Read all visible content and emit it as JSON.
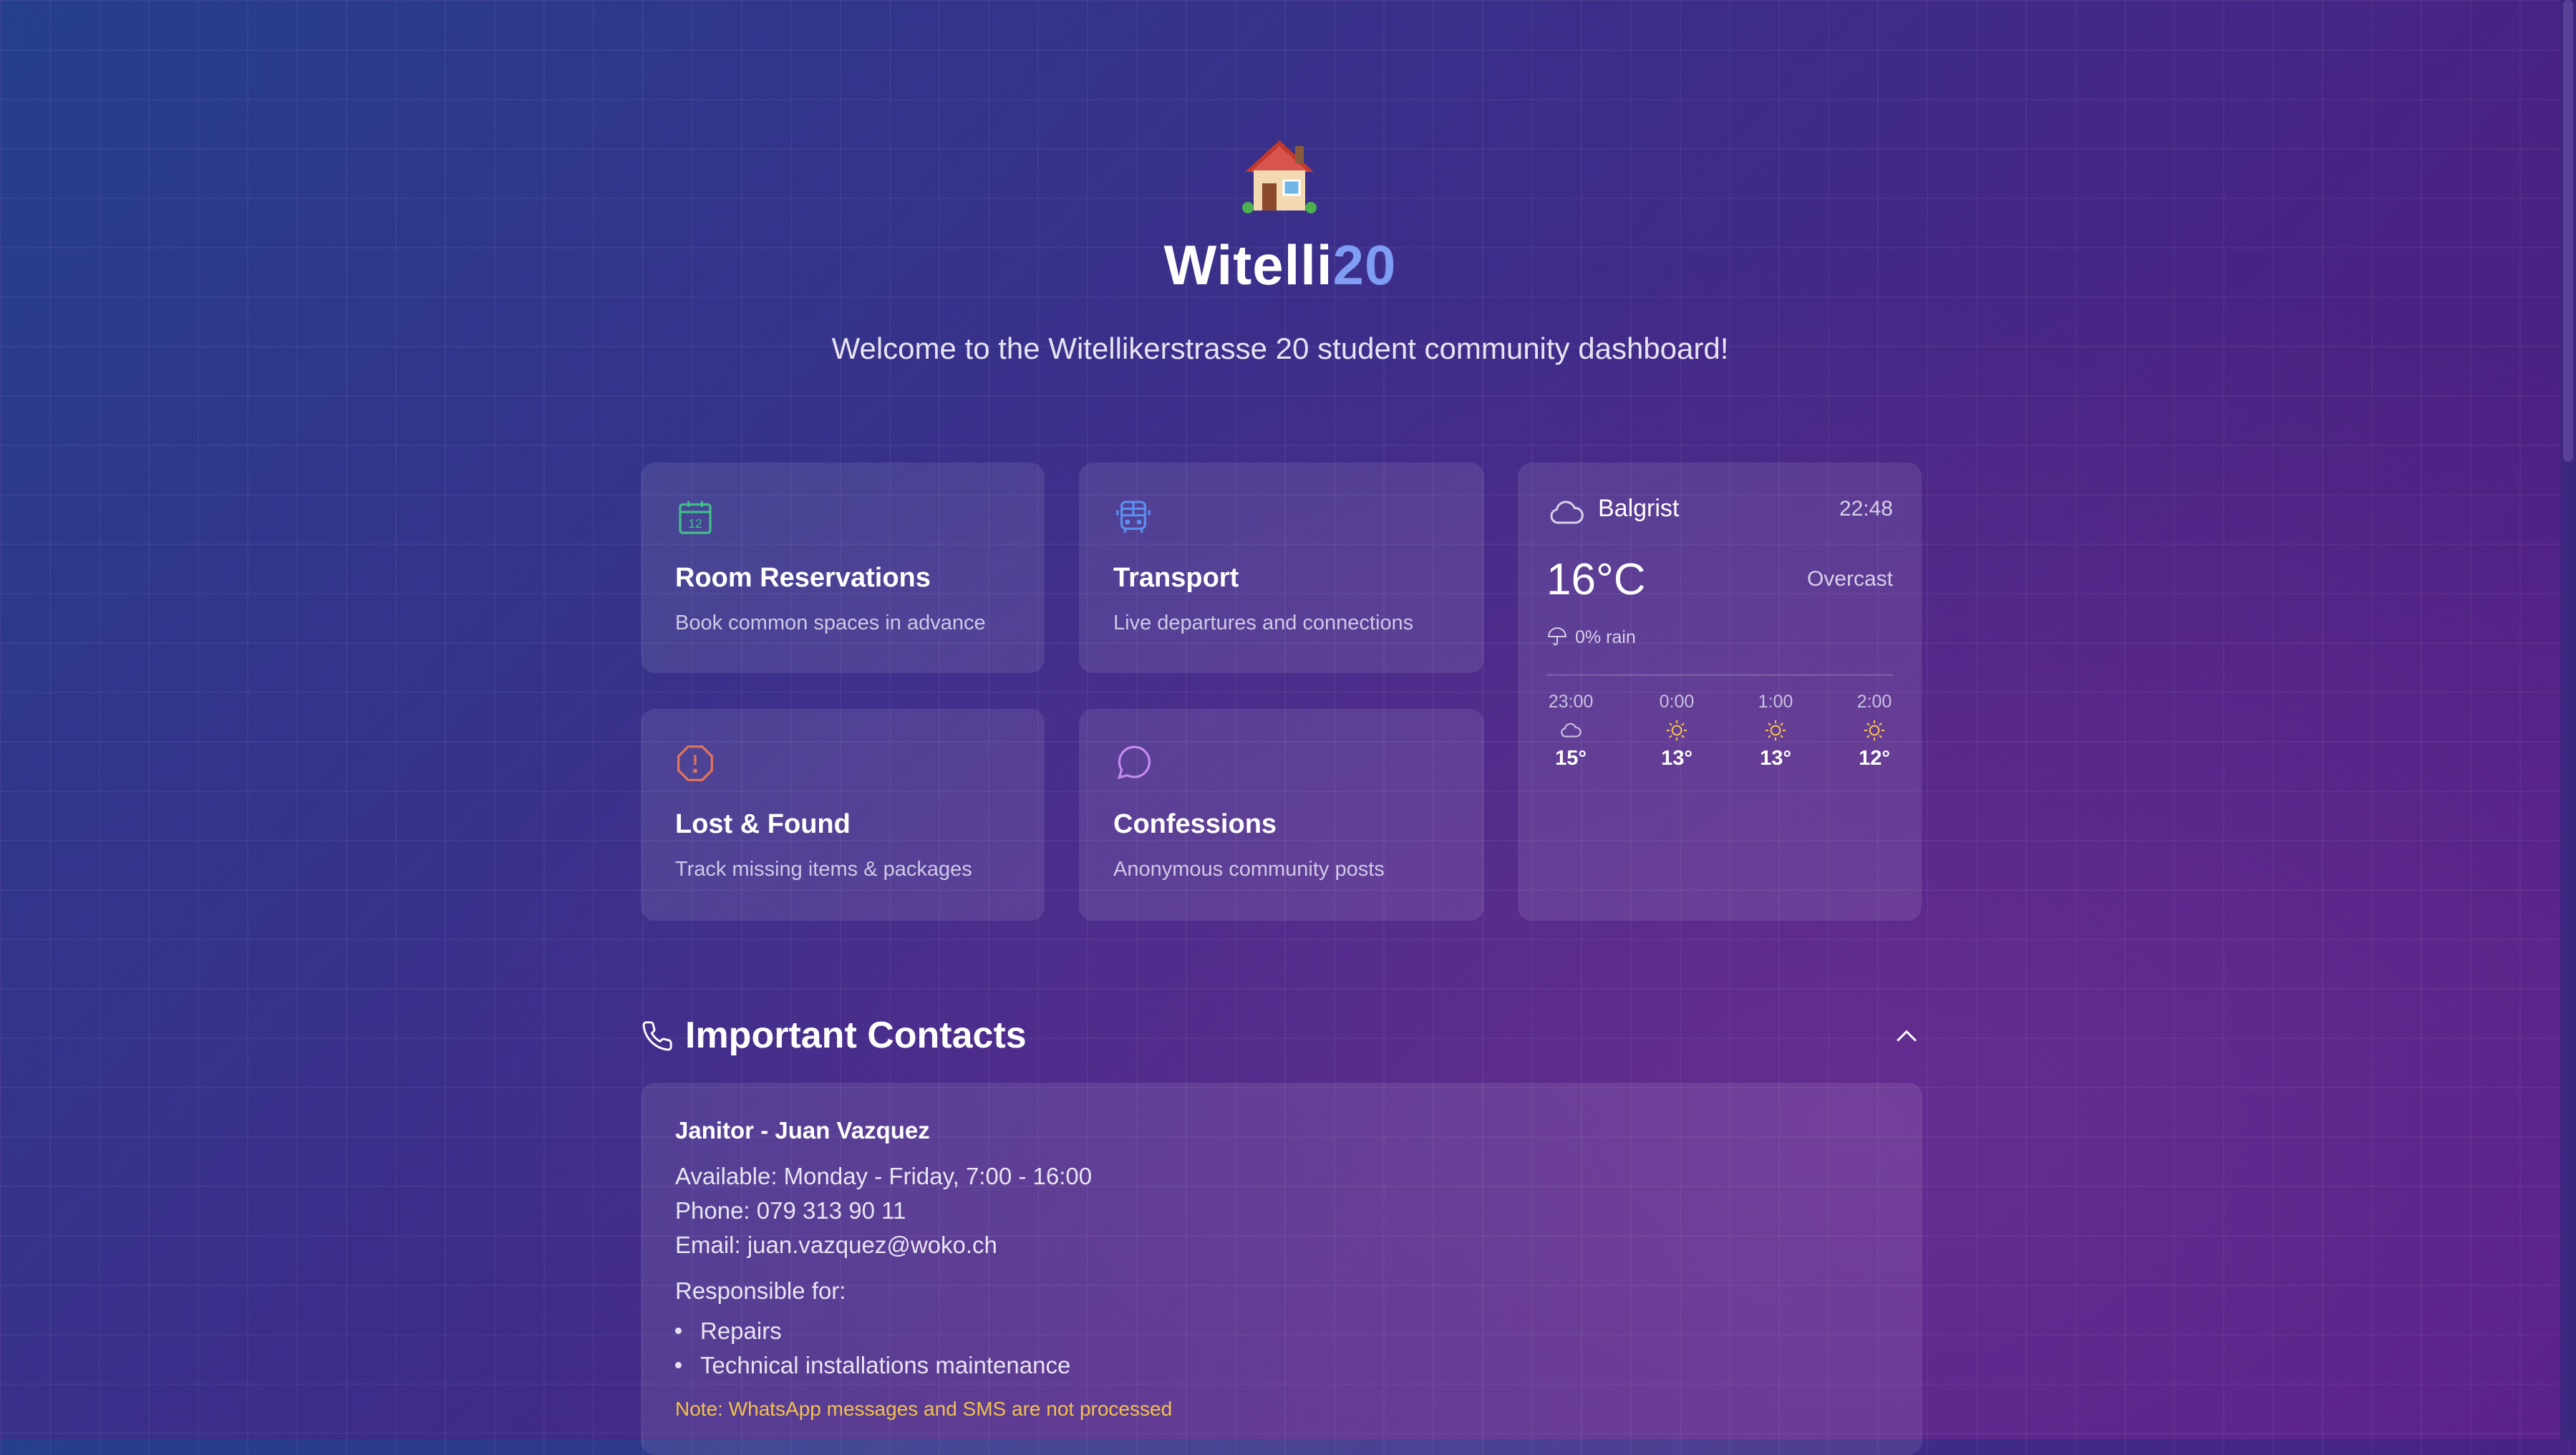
{
  "header": {
    "title_main": "Witelli",
    "title_accent": "20",
    "subtitle": "Welcome to the Witellikerstrasse 20 student community dashboard!",
    "logo_icon": "house-icon"
  },
  "cards": [
    {
      "id": "room-reservations",
      "title": "Room Reservations",
      "desc": "Book common spaces in advance",
      "icon": "calendar-icon",
      "color": "#3fbf8a"
    },
    {
      "id": "transport",
      "title": "Transport",
      "desc": "Live departures and connections",
      "icon": "bus-icon",
      "color": "#5b8ef0"
    },
    {
      "id": "lost-found",
      "title": "Lost & Found",
      "desc": "Track missing items & packages",
      "icon": "alert-octagon-icon",
      "color": "#e0745a"
    },
    {
      "id": "confessions",
      "title": "Confessions",
      "desc": "Anonymous community posts",
      "icon": "message-bubble-icon",
      "color": "#c58af0"
    }
  ],
  "weather": {
    "location": "Balgrist",
    "time": "22:48",
    "temperature": "16°C",
    "condition": "Overcast",
    "rain": "0% rain",
    "hours": [
      {
        "label": "23:00",
        "temp": "15°",
        "icon": "cloud-icon"
      },
      {
        "label": "0:00",
        "temp": "13°",
        "icon": "sun-icon"
      },
      {
        "label": "1:00",
        "temp": "13°",
        "icon": "sun-icon"
      },
      {
        "label": "2:00",
        "temp": "12°",
        "icon": "sun-icon"
      }
    ]
  },
  "contacts": {
    "title": "Important Contacts",
    "items": [
      {
        "name": "Janitor - Juan Vazquez",
        "available": "Available: Monday - Friday, 7:00 - 16:00",
        "phone": "Phone: 079 313 90 11",
        "email": "Email: juan.vazquez@woko.ch",
        "responsible_label": "Responsible for:",
        "responsibilities": [
          "Repairs",
          "Technical installations maintenance"
        ],
        "note": "Note: WhatsApp messages and SMS are not processed"
      }
    ]
  },
  "colors": {
    "accent": "#7f9df2",
    "note": "#f2c14e",
    "sun": "#f2c14e"
  }
}
